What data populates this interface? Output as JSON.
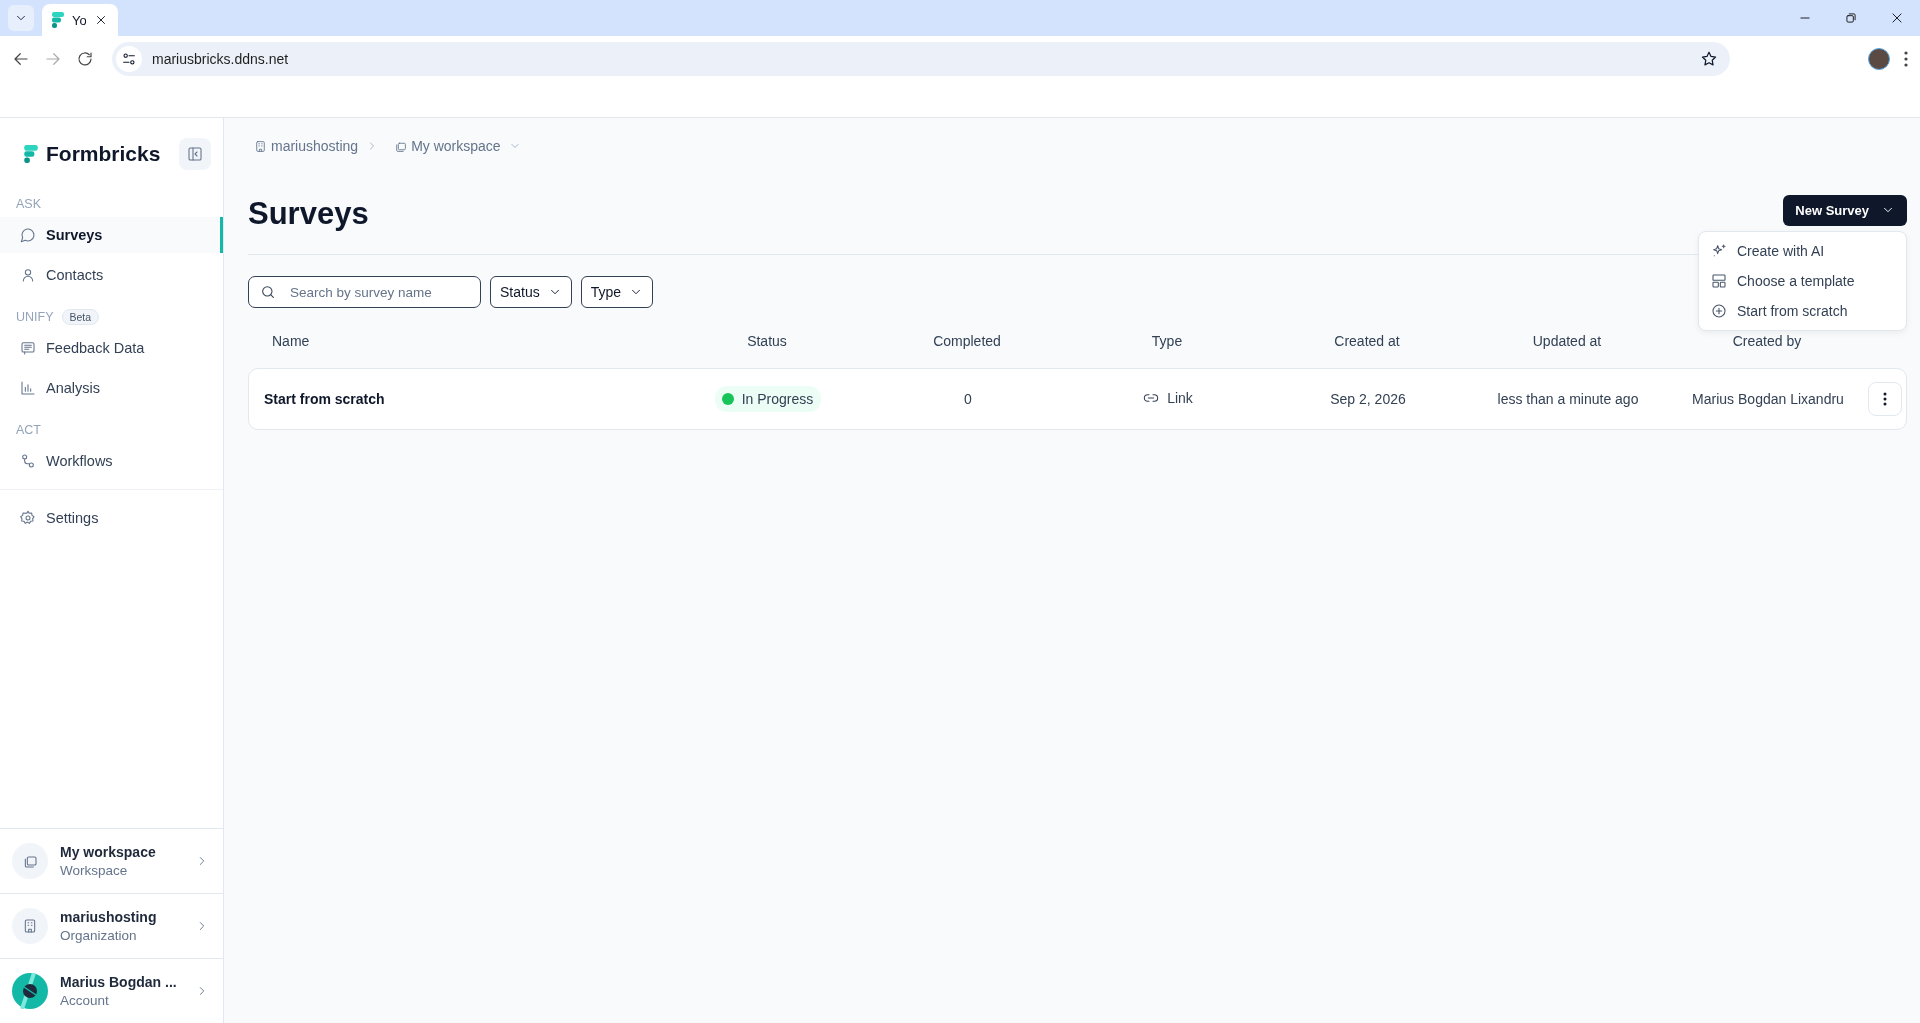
{
  "browser": {
    "tab_title": "Yo",
    "url": "mariusbricks.ddns.net"
  },
  "sidebar": {
    "brand": "Formbricks",
    "sections": [
      {
        "label": "ASK",
        "items": [
          {
            "label": "Surveys",
            "selected": true
          },
          {
            "label": "Contacts",
            "selected": false
          }
        ]
      },
      {
        "label": "UNIFY",
        "badge": "Beta",
        "items": [
          {
            "label": "Feedback Data",
            "selected": false
          },
          {
            "label": "Analysis",
            "selected": false
          }
        ]
      },
      {
        "label": "ACT",
        "items": [
          {
            "label": "Workflows",
            "selected": false
          }
        ]
      }
    ],
    "footer_items": [
      {
        "label": "Settings",
        "selected": false
      }
    ],
    "switchers": [
      {
        "kind": "workspace",
        "title": "My workspace",
        "subtitle": "Workspace"
      },
      {
        "kind": "organization",
        "title": "mariushosting",
        "subtitle": "Organization"
      },
      {
        "kind": "account",
        "title": "Marius Bogdan ...",
        "subtitle": "Account"
      }
    ]
  },
  "breadcrumb": [
    {
      "label": "mariushosting"
    },
    {
      "label": "My workspace"
    }
  ],
  "page": {
    "title": "Surveys",
    "new_button": "New Survey",
    "new_menu": [
      {
        "label": "Create with AI"
      },
      {
        "label": "Choose a template"
      },
      {
        "label": "Start from scratch"
      }
    ],
    "search": {
      "placeholder": "Search by survey name"
    },
    "filters": [
      "Status",
      "Type"
    ]
  },
  "table": {
    "columns": [
      "Name",
      "Status",
      "Completed",
      "Type",
      "Created at",
      "Updated at",
      "Created by"
    ],
    "rows": [
      {
        "name": "Start from scratch",
        "status": "In Progress",
        "completed": "0",
        "type": "Link",
        "created_at": "Sep 2, 2026",
        "updated_at": "less than a minute ago",
        "created_by": "Marius Bogdan Lixandru"
      }
    ]
  }
}
